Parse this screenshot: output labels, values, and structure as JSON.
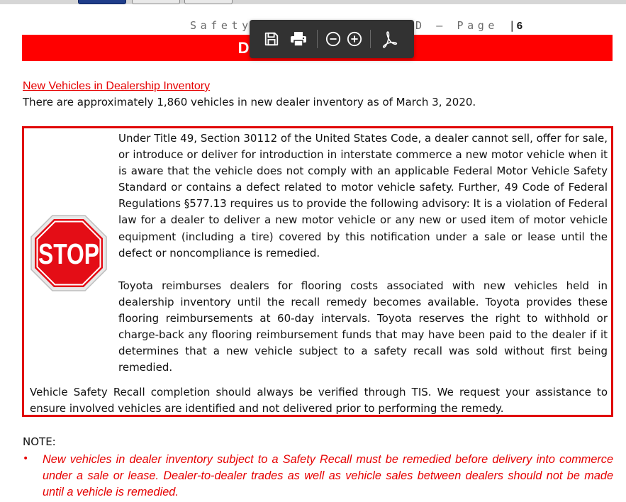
{
  "header": {
    "running_title": "Safety",
    "running_title_tail": "im 20TB02) – D – Page",
    "page_number": "6",
    "banner_title_left": "Deal",
    "banner_title_right": "s"
  },
  "toolbar": {
    "save": "save-icon",
    "print": "print-icon",
    "zoom_out": "zoom-out-icon",
    "zoom_in": "zoom-in-icon",
    "acrobat": "acrobat-icon"
  },
  "section": {
    "heading": "New Vehicles in Dealership Inventory",
    "inventory_sentence": "There are approximately 1,860 vehicles in new dealer inventory as of March 3, 2020."
  },
  "stop_box": {
    "sign_text": "STOP",
    "paragraph1": "Under Title 49, Section 30112 of the United States Code, a dealer cannot sell, offer for sale, or introduce or deliver for introduction in interstate commerce a new motor vehicle when it is aware that the vehicle does not comply with an applicable Federal Motor Vehicle Safety Standard or contains a defect related to motor vehicle safety.  Further, 49 Code of Federal Regulations §577.13 requires us to provide the following advisory:  It is a violation of Federal law for a dealer to deliver a new motor vehicle or any new or used item of motor vehicle equipment (including a tire) covered by this notification under a sale or lease until the defect or noncompliance is remedied.",
    "paragraph2": "Toyota reimburses dealers for flooring costs associated with new vehicles held in dealership inventory until the recall remedy becomes available.  Toyota provides these flooring reimbursements at 60-day intervals.  Toyota reserves the right to withhold or charge-back any flooring reimbursement funds that may have been paid to the dealer if it determines that a new vehicle subject to a safety recall was sold without first being remedied.",
    "paragraph3": "Vehicle Safety Recall completion should always be verified through TIS. We request your assistance to ensure involved vehicles are identified and not delivered prior to performing the remedy."
  },
  "note": {
    "label": "NOTE:",
    "bullet": "•",
    "text": "New vehicles in dealer inventory subject to a Safety Recall must be remedied before delivery into commerce under a sale or lease. Dealer-to-dealer trades as well as vehicle sales between dealers should not be made until a vehicle is remedied."
  },
  "colors": {
    "accent_red": "#ff0000",
    "toolbar_bg": "#323232"
  }
}
